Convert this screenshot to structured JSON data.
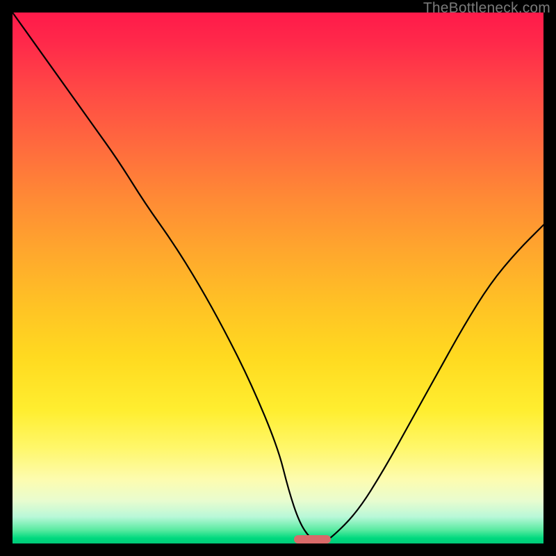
{
  "watermark": "TheBottleneck.com",
  "chart_data": {
    "type": "line",
    "title": "",
    "xlabel": "",
    "ylabel": "",
    "xlim": [
      0,
      100
    ],
    "ylim": [
      0,
      100
    ],
    "x": [
      0,
      5,
      10,
      15,
      20,
      25,
      30,
      35,
      40,
      45,
      50,
      52,
      54,
      56,
      58,
      60,
      65,
      70,
      75,
      80,
      85,
      90,
      95,
      100
    ],
    "values": [
      100,
      93,
      86,
      79,
      72,
      64,
      57,
      49,
      40,
      30,
      18,
      10,
      4,
      1,
      0,
      1,
      6,
      14,
      23,
      32,
      41,
      49,
      55,
      60
    ],
    "marker": {
      "x_start": 53,
      "x_end": 60,
      "y": 0
    },
    "gradient_scale": {
      "top_color": "#ff1a4a",
      "top_value": 100,
      "bottom_color": "#00c97a",
      "bottom_value": 0
    }
  },
  "colors": {
    "frame": "#000000",
    "curve": "#000000",
    "marker": "#d96a6a",
    "watermark": "#7a7a7a"
  }
}
